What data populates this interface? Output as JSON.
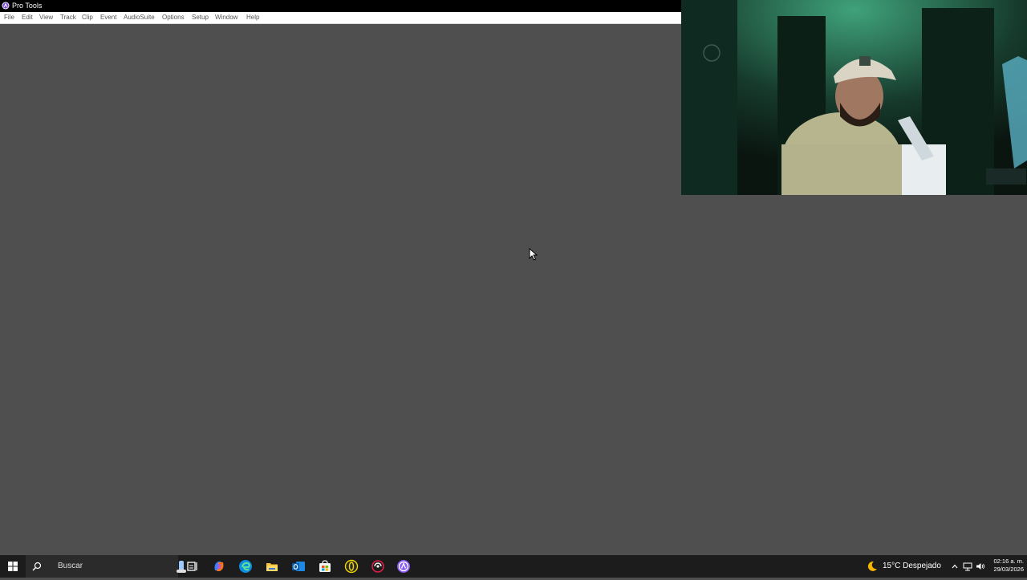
{
  "window": {
    "title": "Pro Tools"
  },
  "menu": {
    "items": [
      "File",
      "Edit",
      "View",
      "Track",
      "Clip",
      "Event",
      "AudioSuite",
      "Options",
      "Setup",
      "Window",
      "Help"
    ]
  },
  "taskbar": {
    "search_placeholder": "Buscar",
    "pinned_apps": [
      "task-view",
      "copilot",
      "edge",
      "file-explorer",
      "outlook",
      "microsoft-store",
      "app-yellow-ring",
      "app-red-circle",
      "pro-tools"
    ],
    "weather": {
      "temperature": "15°C",
      "condition": "Despejado",
      "text": "15°C  Despejado"
    },
    "clock": {
      "time": "02:16 a. m.",
      "date": "29/03/2026"
    }
  },
  "colors": {
    "workspace_bg": "#4f4f4f",
    "titlebar_bg": "#000000",
    "menubar_bg": "#ffffff",
    "taskbar_bg": "#1c1c1c",
    "pro_tools_accent": "#8b5cf6"
  }
}
